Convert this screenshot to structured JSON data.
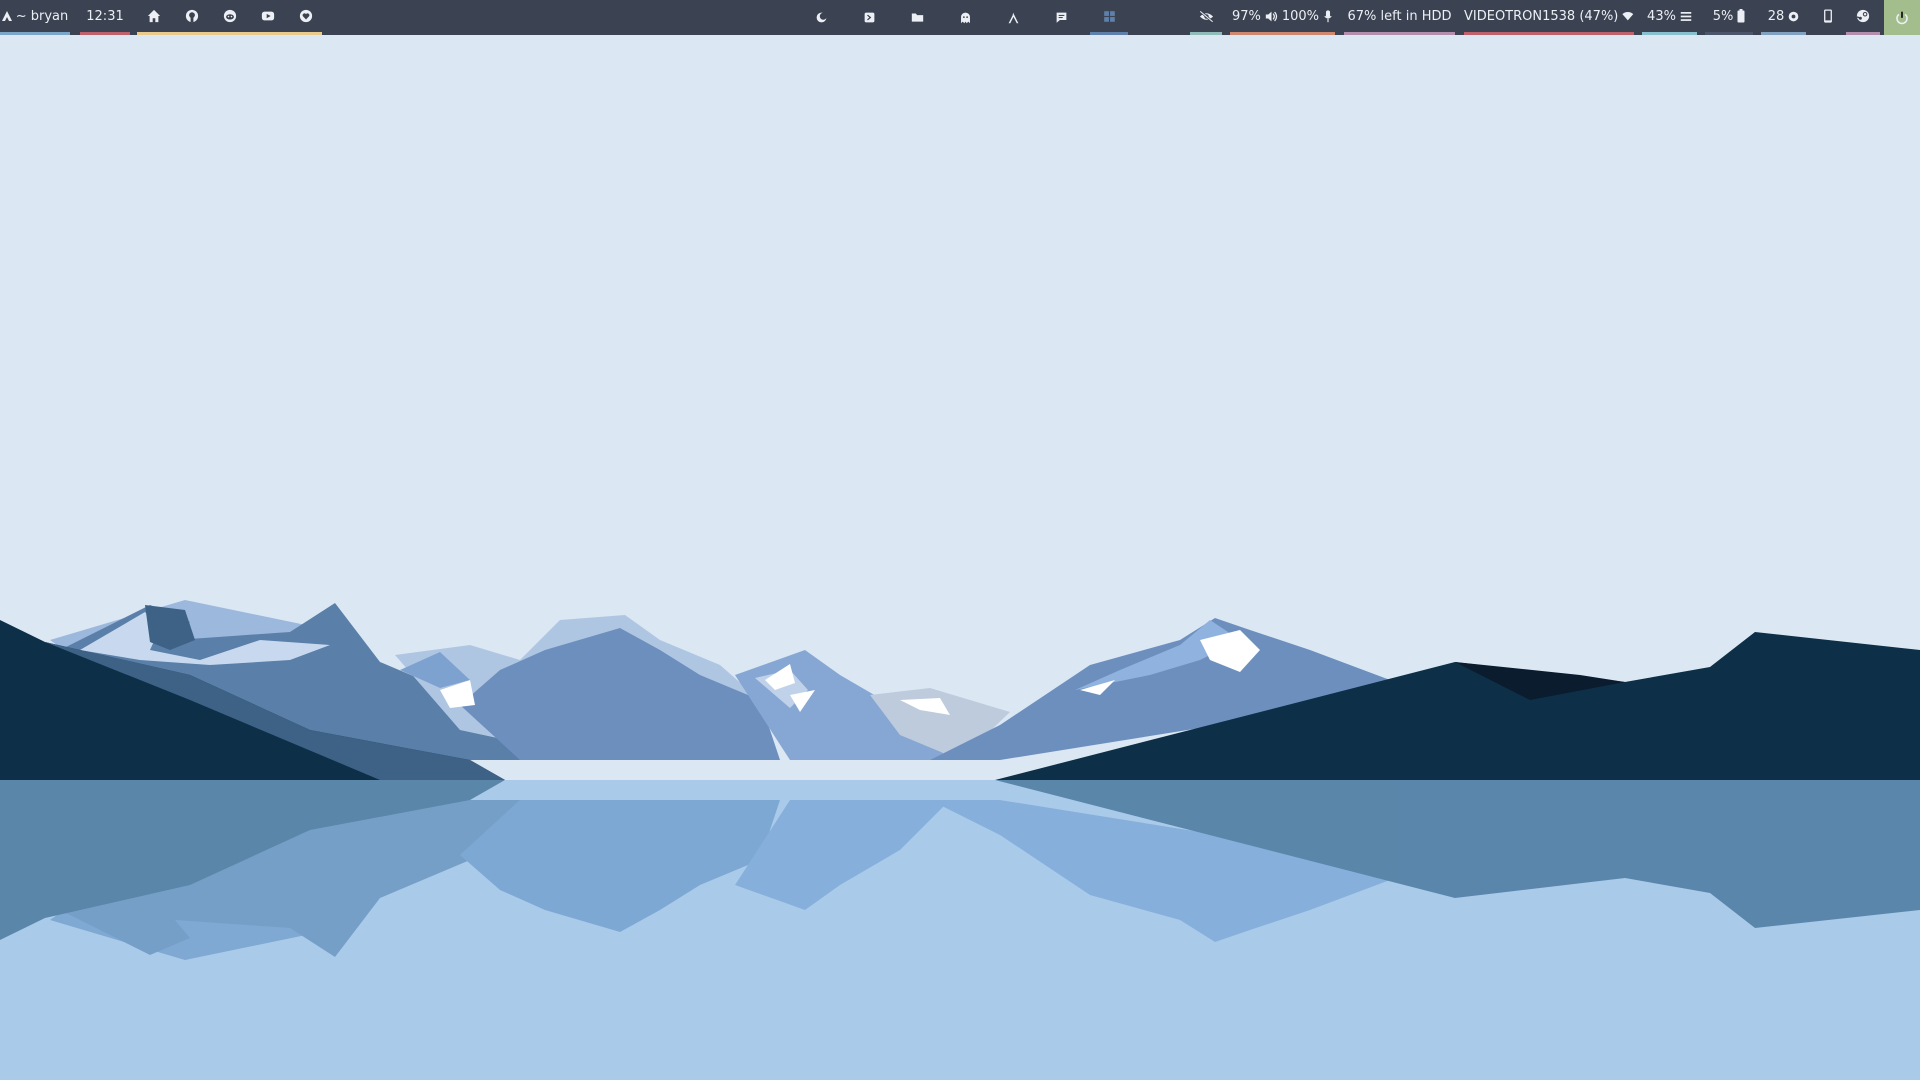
{
  "topbar": {
    "launcher": {
      "label": "~ bryan",
      "icon": "arch-icon"
    },
    "clock": {
      "time": "12:31"
    },
    "bookmarks": [
      {
        "name": "home-icon"
      },
      {
        "name": "github-icon"
      },
      {
        "name": "reddit-icon"
      },
      {
        "name": "youtube-icon"
      },
      {
        "name": "heart-icon"
      }
    ],
    "workspaces": [
      {
        "icon": "moon-icon",
        "active": false
      },
      {
        "icon": "terminal-icon",
        "active": false
      },
      {
        "icon": "folder-icon",
        "active": false
      },
      {
        "icon": "ghost-icon",
        "active": false
      },
      {
        "icon": "lambda-icon",
        "active": false
      },
      {
        "icon": "chat-icon",
        "active": false
      },
      {
        "icon": "grid-icon",
        "active": true
      }
    ],
    "status": {
      "privacy_icon": "eye-slash-icon",
      "volume": "97%",
      "mic": "100%",
      "disk": "67% left in HDD",
      "wifi": "VIDEOTRON1538 (47%)",
      "memory": "43%",
      "battery": "5%",
      "updates": "28"
    },
    "colors": {
      "bar_bg": "#3b4252",
      "text": "#eceff4",
      "power_bg": "#a3be8c",
      "accent_blue": "#5e81ac"
    }
  },
  "wallpaper": {
    "sky": "#dbe7f3",
    "water": "#a9cbe9"
  }
}
